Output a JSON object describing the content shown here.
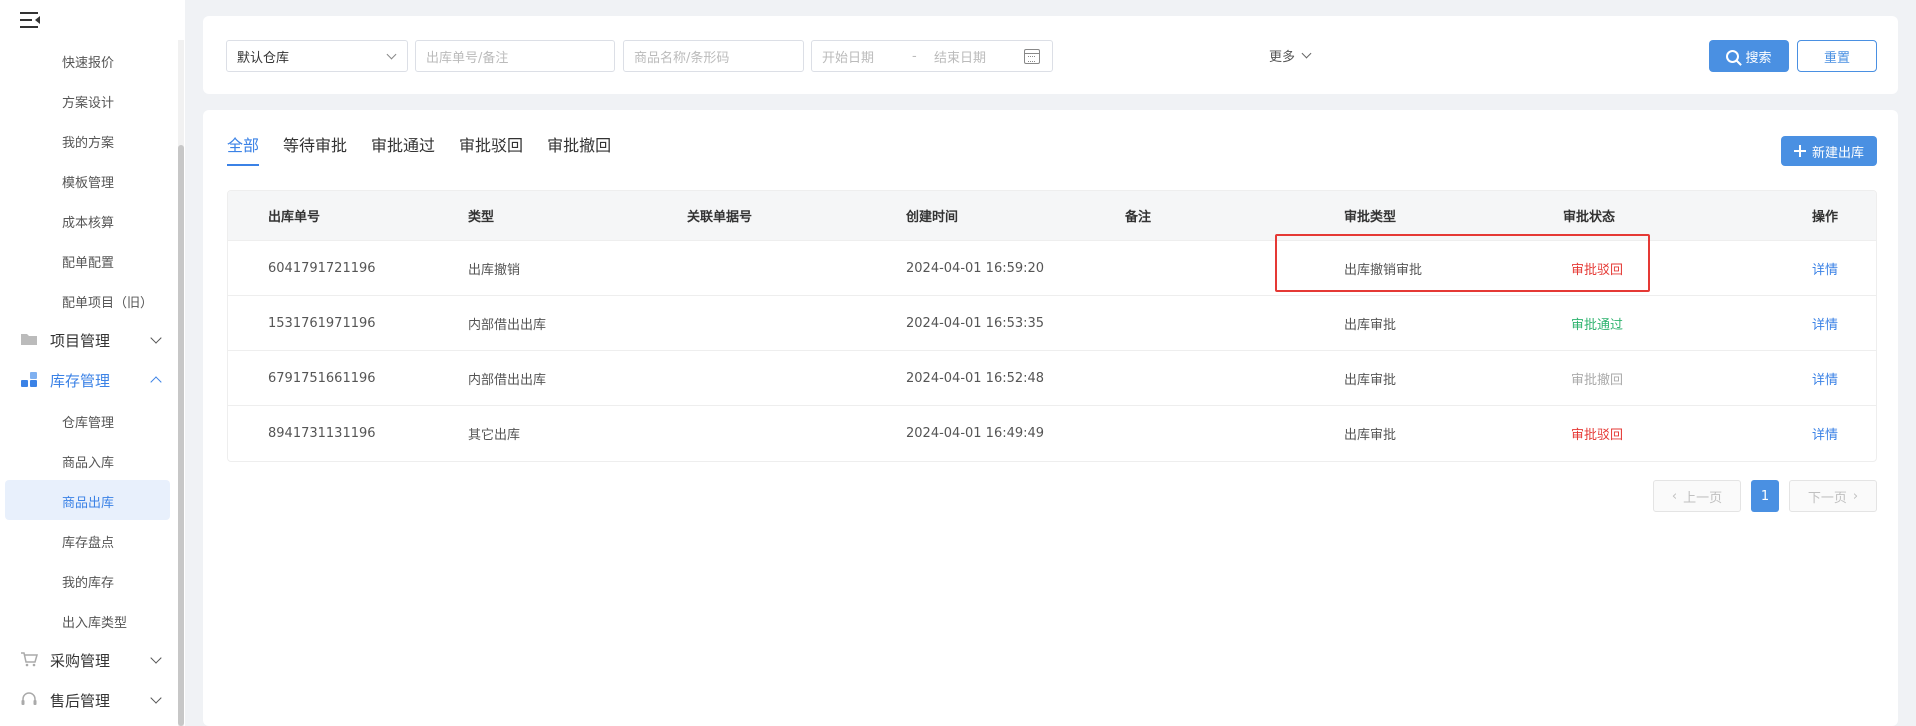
{
  "sidebar": {
    "sub_items_top": [
      "快速报价",
      "方案设计",
      "我的方案",
      "模板管理",
      "成本核算",
      "配单配置",
      "配单项目（旧）"
    ],
    "groups": {
      "project": "项目管理",
      "inventory": "库存管理",
      "purchase": "采购管理",
      "aftersales": "售后管理"
    },
    "inventory_items": [
      "仓库管理",
      "商品入库",
      "商品出库",
      "库存盘点",
      "我的库存",
      "出入库类型"
    ],
    "active_item": "商品出库"
  },
  "filters": {
    "warehouse_value": "默认仓库",
    "outbound_placeholder": "出库单号/备注",
    "product_placeholder": "商品名称/条形码",
    "start_date_placeholder": "开始日期",
    "date_separator": "-",
    "end_date_placeholder": "结束日期",
    "more_label": "更多",
    "search_label": "搜索",
    "reset_label": "重置"
  },
  "tabs": [
    "全部",
    "等待审批",
    "审批通过",
    "审批驳回",
    "审批撤回"
  ],
  "active_tab": "全部",
  "new_outbound_label": "新建出库",
  "table": {
    "columns": [
      "出库单号",
      "类型",
      "关联单据号",
      "创建时间",
      "备注",
      "审批类型",
      "审批状态",
      "操作"
    ],
    "rows": [
      {
        "id": "6041791721196",
        "type": "出库撤销",
        "ref": "",
        "created": "2024-04-01 16:59:20",
        "note": "",
        "approval_type": "出库撤销审批",
        "status": "审批驳回",
        "status_color": "#e53935",
        "action": "详情"
      },
      {
        "id": "1531761971196",
        "type": "内部借出出库",
        "ref": "",
        "created": "2024-04-01 16:53:35",
        "note": "",
        "approval_type": "出库审批",
        "status": "审批通过",
        "status_color": "#2fb36f",
        "action": "详情"
      },
      {
        "id": "6791751661196",
        "type": "内部借出出库",
        "ref": "",
        "created": "2024-04-01 16:52:48",
        "note": "",
        "approval_type": "出库审批",
        "status": "审批撤回",
        "status_color": "#aaaaaa",
        "action": "详情"
      },
      {
        "id": "8941731131196",
        "type": "其它出库",
        "ref": "",
        "created": "2024-04-01 16:49:49",
        "note": "",
        "approval_type": "出库审批",
        "status": "审批驳回",
        "status_color": "#e53935",
        "action": "详情"
      }
    ]
  },
  "pagination": {
    "prev_label": "上一页",
    "current_page": "1",
    "next_label": "下一页"
  },
  "colors": {
    "accent": "#4a90e2",
    "highlight_border": "#e53935"
  }
}
